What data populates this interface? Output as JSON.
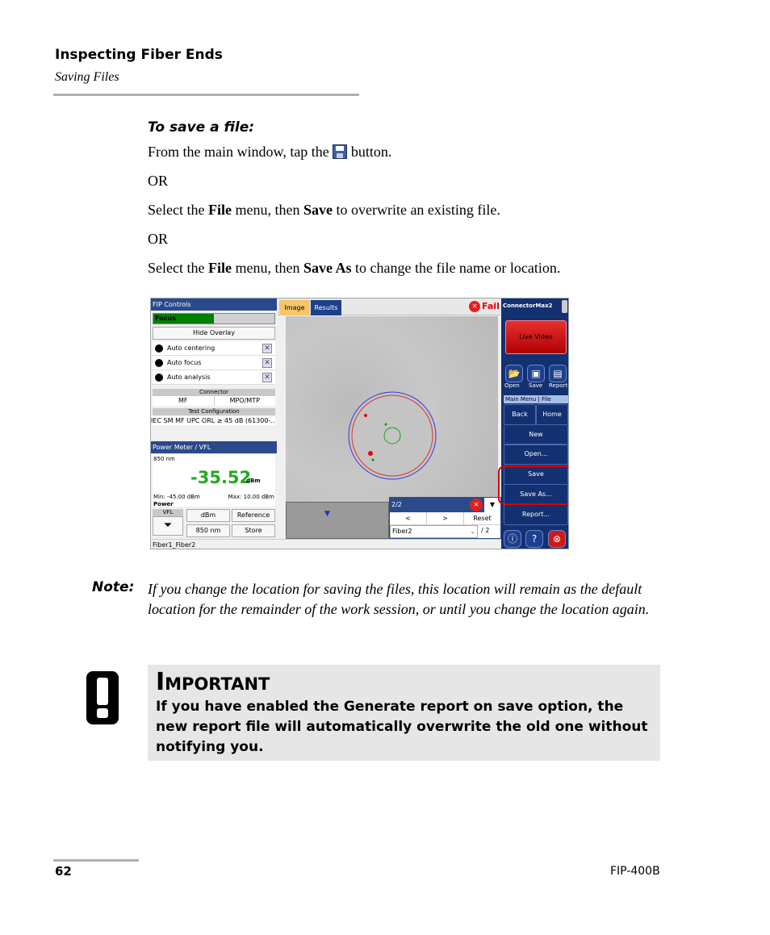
{
  "header": {
    "title": "Inspecting Fiber Ends",
    "subtitle": "Saving Files"
  },
  "procedure": {
    "title": "To save a file:",
    "step1_pre": "From the main window, tap the",
    "step1_post": "button.",
    "or": "OR",
    "step2": {
      "pre": "Select the ",
      "file": "File",
      "mid": " menu, then ",
      "save": "Save",
      "post": " to overwrite an existing file."
    },
    "step3": {
      "pre": "Select the ",
      "file": "File",
      "mid": " menu, then ",
      "save": "Save As",
      "post": " to change the file name or location."
    }
  },
  "app": {
    "left": {
      "title": "FIP Controls",
      "focus": "Focus",
      "focus_level": 0.5,
      "hide_overlay": "Hide Overlay",
      "options": [
        "Auto centering",
        "Auto focus",
        "Auto analysis"
      ],
      "connector_label": "Connector",
      "connector": [
        "MF",
        "MPO/MTP"
      ],
      "test_config_label": "Test Configuration",
      "test_config": "IEC SM MF UPC ORL ≥ 45 dB (61300-...",
      "pm_title": "Power Meter / VFL",
      "wavelength": "850 nm",
      "value": "-35.52",
      "unit": "dBm",
      "min": "Min: -45.00 dBm",
      "max": "Max: 10.00 dBm",
      "power": "Power",
      "vfl": "VFL",
      "btn_dbm": "dBm",
      "btn_reference": "Reference",
      "btn_850": "850 nm",
      "btn_store": "Store"
    },
    "tabs": [
      "Image",
      "Results"
    ],
    "status": "Fail",
    "nav": {
      "counter": "2/2",
      "prev": "<",
      "next": ">",
      "reset": "Reset",
      "fiber": "Fiber2",
      "total": "/ 2"
    },
    "statusbar": "Fiber1_Fiber2",
    "right": {
      "brand": "ConnectorMax2",
      "live_video": "Live Video",
      "open": "Open",
      "save": "Save",
      "report": "Report",
      "breadcrumb": "Main Menu | File",
      "back": "Back",
      "home": "Home",
      "menu": [
        "New",
        "Open...",
        "Save",
        "Save As...",
        "Report..."
      ]
    },
    "highlight_color": "#e00000",
    "accent": "#2b4a8c"
  },
  "note": {
    "label": "Note:",
    "text": "If you change the location for saving the files, this location will remain as the default location for the remainder of the work session, or until you change the location again."
  },
  "important": {
    "title": "Important",
    "text": "If you have enabled the Generate report on save option, the new report file will automatically overwrite the old one without notifying you."
  },
  "footer": {
    "page": "62",
    "product": "FIP-400B"
  }
}
